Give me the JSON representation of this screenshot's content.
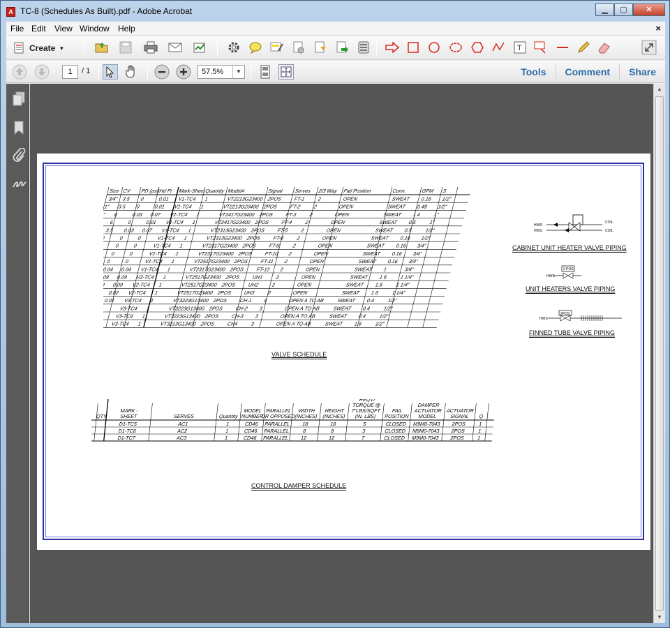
{
  "window": {
    "title": "TC-8 (Schedules As Built).pdf - Adobe Acrobat",
    "app_icon": "acrobat-icon"
  },
  "menu": [
    "File",
    "Edit",
    "View",
    "Window",
    "Help"
  ],
  "menu_close": "×",
  "toolbar": {
    "create_label": "Create",
    "icons": [
      "open-folder-icon",
      "save-icon",
      "print-icon",
      "email-icon",
      "sign-icon",
      "settings-icon",
      "comment-icon",
      "highlight-icon",
      "attach-file-icon",
      "stamp-icon",
      "export-icon",
      "print-production-icon",
      "arrow-icon",
      "rectangle-icon",
      "oval-icon",
      "cloud-icon",
      "polygon-icon",
      "connected-lines-icon",
      "text-box-icon",
      "text-callout-icon",
      "line-icon",
      "pencil-icon",
      "eraser-icon",
      "expand-icon"
    ]
  },
  "nav": {
    "page_current": "1",
    "page_total": "/ 1",
    "zoom": "57.5%",
    "links": [
      "Tools",
      "Comment",
      "Share"
    ]
  },
  "sidebar_icons": [
    "pages-icon",
    "bookmark-icon",
    "attachment-icon",
    "signature-icon"
  ],
  "drawing": {
    "valve_schedule": {
      "caption": "VALVE SCHEDULE",
      "headers": [
        "Size",
        "CV",
        "PD (psi)",
        "Hd Ft",
        "Mark-Sheet",
        "Quantity",
        "Model#",
        "Signal",
        "Serves",
        "2/3 Way",
        "Fail Position",
        "Conn.",
        "GPM",
        "S"
      ],
      "rows": [
        [
          "3/4\"",
          "3.5",
          "0",
          "0.01",
          "V1-TC4",
          "1",
          "VT2213G23400",
          "2POS",
          "FT-1",
          "2",
          "OPEN",
          "SWEAT",
          "0.16",
          "1/2\""
        ],
        [
          "1\"",
          "3.5",
          "0",
          "0.01",
          "V1-TC4",
          "1",
          "VT2213G23400",
          "2POS",
          "FT-2",
          "2",
          "OPEN",
          "SWEAT",
          "0.48",
          "1/2\""
        ],
        [
          "1\"",
          "6",
          "0.03",
          "0.07",
          "V1-TC4",
          "1",
          "VT2417G23400",
          "2POS",
          "FT-3",
          "2",
          "OPEN",
          "SWEAT",
          "1.4",
          "1\""
        ],
        [
          "1\"",
          "6",
          "0",
          "0.01",
          "V1-TC4",
          "1",
          "VT2417G23400",
          "2POS",
          "FT-4",
          "2",
          "OPEN",
          "SWEAT",
          "0.5",
          "1\""
        ],
        [
          "1/2\"",
          "3.5",
          "0.03",
          "0.07",
          "V1-TC4",
          "1",
          "VT2313G23400",
          "2POS",
          "FT-5",
          "2",
          "OPEN",
          "SWEAT",
          "0.5",
          "1/2\""
        ],
        [
          "1/2\"",
          "0",
          "0",
          "0",
          "V1-TC4",
          "1",
          "VT2313G23400",
          "2POS",
          "FT-6",
          "2",
          "OPEN",
          "SWEAT",
          "0.16",
          "1/2\""
        ],
        [
          "1/2\"",
          "0",
          "0",
          "0",
          "V1-TC4",
          "1",
          "VT2317G23400",
          "2POS",
          "FT-8",
          "2",
          "OPEN",
          "SWEAT",
          "0.16",
          "3/4\""
        ],
        [
          "1/2\"",
          "0",
          "0",
          "0",
          "V1-TC4",
          "1",
          "VT2317G23400",
          "2POS",
          "FT-10",
          "2",
          "OPEN",
          "SWEAT",
          "0.16",
          "3/4\""
        ],
        [
          "1/2\"",
          "0",
          "0",
          "0",
          "V1-TC4",
          "1",
          "VT2517G23400",
          "2POS",
          "FT-11",
          "2",
          "OPEN",
          "SWEAT",
          "0.16",
          "3/4\""
        ],
        [
          "1\"",
          "0.02",
          "0.04",
          "0.04",
          "V1-TC4",
          "1",
          "VT2317G23400",
          "2POS",
          "FT-12",
          "2",
          "OPEN",
          "SWEAT",
          "1",
          "3/4\""
        ],
        [
          "1\"",
          "0.09",
          "0.09",
          "0.09",
          "V2-TC4",
          "1",
          "VT2517G23400",
          "2POS",
          "UH1",
          "2",
          "OPEN",
          "SWEAT",
          "1.6",
          "1 1/4\""
        ],
        [
          "1\"",
          "0.09",
          "0.09",
          "0.09",
          "V2-TC4",
          "1",
          "VT2517G23400",
          "2POS",
          "UH2",
          "2",
          "OPEN",
          "SWEAT",
          "1.6",
          "1 1/4\""
        ],
        [
          "1\"",
          "0.02",
          "0.02",
          "0.02",
          "V2-TC4",
          "1",
          "VT2517G23400",
          "2POS",
          "UH3",
          "2",
          "OPEN",
          "SWEAT",
          "1.6",
          "1 1/4\""
        ],
        [
          "1\"",
          "0.01",
          "0.01",
          "0.01",
          "V3-TC4",
          "1",
          "VT3223G13400",
          "2POS",
          "CH-1",
          "3",
          "OPEN A TO AB",
          "SWEAT",
          "0.4",
          "1/2\""
        ],
        [
          "1\"",
          "0",
          "0",
          "0",
          "V3-TC4",
          "1",
          "VT3223G13400",
          "2POS",
          "CH-2",
          "3",
          "OPEN A TO AB",
          "SWEAT",
          "0.4",
          "1/2\""
        ],
        [
          "1\"",
          "0",
          "0",
          "0",
          "V3-TC4",
          "1",
          "VT3223G13400",
          "2POS",
          "CH-3",
          "3",
          "OPEN A TO AB",
          "SWEAT",
          "0.4",
          "1/2\""
        ],
        [
          "1\"",
          "0",
          "0",
          "0",
          "V3-TC4",
          "1",
          "VT3213G13400",
          "2POS",
          "CH4",
          "3",
          "OPEN A TO AB",
          "SWEAT",
          "1.6",
          "1/2\""
        ]
      ]
    },
    "piping_details": [
      {
        "caption": "CABINET UNIT HEATER VALVE PIPING",
        "labels": [
          "HWR",
          "HWS",
          "COIL",
          "COIL"
        ]
      },
      {
        "caption": "UNIT HEATERS VALVE PIPING",
        "labels": [
          "2 POS",
          "HWS"
        ]
      },
      {
        "caption": "FINNED TUBE VALVE PIPING",
        "labels": [
          "2POS",
          "HWS"
        ]
      }
    ],
    "damper_schedule": {
      "caption": "CONTROL DAMPER SCHEDULE",
      "headers": [
        "QTY",
        "MARK - SHEET",
        "SERVES",
        "Quantity",
        "MODEL NUMBER",
        "PARALLEL OR OPPOSED",
        "WIDTH (INCHES)",
        "HEIGHT (INCHES)",
        "REQ'D TORQUE @ 7\"LBS/SQFT (IN. LBS)",
        "FAIL POSITION",
        "DAMPER ACTUATOR MODEL",
        "ACTUATOR SIGNAL",
        "Q"
      ],
      "rows": [
        [
          "",
          "D1-TC5",
          "AC1",
          "1",
          "CD46",
          "PARALLEL",
          "18",
          "18",
          "5",
          "CLOSED",
          "M9M0-7043",
          "2POS",
          "1"
        ],
        [
          "",
          "D1-TC6",
          "AC2",
          "1",
          "CD46",
          "PARALLEL",
          "8",
          "8",
          "3",
          "CLOSED",
          "M9M0-7043",
          "2POS",
          "1"
        ],
        [
          "",
          "D1-TC7",
          "AC3",
          "1",
          "CD46",
          "PARALLEL",
          "12",
          "12",
          "7",
          "CLOSED",
          "M9M0-7043",
          "2POS",
          "1"
        ]
      ]
    }
  },
  "colors": {
    "link": "#2e6da8",
    "border": "#2b2fa0",
    "doc_bg": "#555555",
    "annot_red": "#d9261c"
  }
}
